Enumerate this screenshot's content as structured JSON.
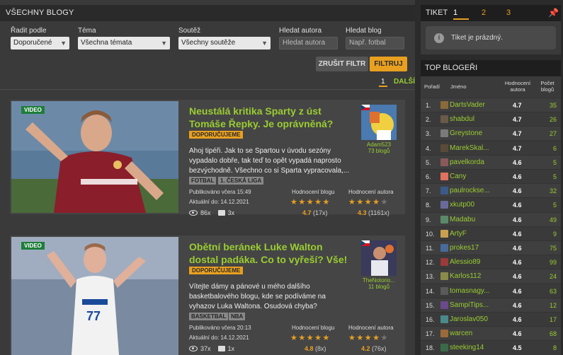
{
  "left": {
    "header": "VŠECHNY BLOGY",
    "filters": {
      "sort": {
        "label": "Řadit podle",
        "value": "Doporučené"
      },
      "topic": {
        "label": "Téma",
        "value": "Všechna témata"
      },
      "contest": {
        "label": "Soutěž",
        "value": "Všechny soutěže"
      },
      "author": {
        "label": "Hledat autora",
        "placeholder": "Hledat autora"
      },
      "blog": {
        "label": "Hledat blog",
        "placeholder": "Např. fotbal"
      }
    },
    "reset_label": "ZRUŠIT FILTR",
    "filter_label": "FILTRUJ",
    "pager": {
      "current": "1",
      "next": "DALŠÍ"
    }
  },
  "blogs": [
    {
      "badge": "VIDEO",
      "title": "Neustálá kritika Sparty z úst Tomáše Řepky. Je oprávněná?",
      "recommended": "DOPORUČUJEME",
      "excerpt": "Ahoj tipéři. Jak to se Spartou v úvodu sezóny vypadalo dobře, tak teď to opět vypadá naprosto bezvýchodně. Všechno co si Sparta vypracovala,...",
      "tags": [
        "FOTBAL",
        "1. ČESKÁ LIGA"
      ],
      "published": "Publikováno včera 15:49",
      "updated": "Aktuální do: 14.12.2021",
      "views": "86x",
      "comments": "3x",
      "blog_rating_label": "Hodnocení blogu",
      "author_rating_label": "Hodnocení autora",
      "blog_rating": "4.7",
      "blog_rating_count": "(17x)",
      "author_rating": "4.3",
      "author_rating_count": "(1161x)",
      "blog_stars": 5,
      "author_stars": 4,
      "author_name": "Adam523",
      "author_blogs": "73 blogů"
    },
    {
      "badge": "VIDEO",
      "title": "Obětní beránek Luke Walton dostal padáka. Co to vyřeší? Vše!",
      "recommended": "DOPORUČUJEME",
      "excerpt": "Vítejte dámy a pánové u mého dalšího basketbalového blogu, kde se podíváme na vyhazov Luka Waltona. Osudová chyba? Nemyslím...",
      "tags": [
        "BASKETBAL",
        "NBA"
      ],
      "published": "Publikováno včera 20:13",
      "updated": "Aktuální do: 14.12.2021",
      "views": "37x",
      "comments": "1x",
      "blog_rating_label": "Hodnocení blogu",
      "author_rating_label": "Hodnocení autora",
      "blog_rating": "4.8",
      "blog_rating_count": "(8x)",
      "author_rating": "4.2",
      "author_rating_count": "(76x)",
      "blog_stars": 5,
      "author_stars": 4,
      "author_name": "TheNotorio...",
      "author_blogs": "11 blogů"
    }
  ],
  "tiket": {
    "title": "TIKET",
    "tabs": [
      "1",
      "2",
      "3"
    ],
    "empty": "Tiket je prázdný."
  },
  "top": {
    "header": "TOP BLOGEŘI",
    "col_rank": "Pořadí",
    "col_name": "Jméno",
    "col_score": "Hodnocení autora",
    "col_count": "Počet blogů",
    "rows": [
      {
        "rank": "1.",
        "name": "DartsVader",
        "score": "4.7",
        "count": "35"
      },
      {
        "rank": "2.",
        "name": "shabdul",
        "score": "4.7",
        "count": "26"
      },
      {
        "rank": "3.",
        "name": "Greystone",
        "score": "4.7",
        "count": "27"
      },
      {
        "rank": "4.",
        "name": "MarekSkal...",
        "score": "4.7",
        "count": "6"
      },
      {
        "rank": "5.",
        "name": "pavelkorda",
        "score": "4.6",
        "count": "5"
      },
      {
        "rank": "6.",
        "name": "Cany",
        "score": "4.6",
        "count": "5"
      },
      {
        "rank": "7.",
        "name": "paulrockse...",
        "score": "4.6",
        "count": "32"
      },
      {
        "rank": "8.",
        "name": "xkutp00",
        "score": "4.6",
        "count": "5"
      },
      {
        "rank": "9.",
        "name": "Madabu",
        "score": "4.6",
        "count": "49"
      },
      {
        "rank": "10.",
        "name": "ArtyF",
        "score": "4.6",
        "count": "9"
      },
      {
        "rank": "11.",
        "name": "prokes17",
        "score": "4.6",
        "count": "75"
      },
      {
        "rank": "12.",
        "name": "Alessio89",
        "score": "4.6",
        "count": "99"
      },
      {
        "rank": "13.",
        "name": "Karlos112",
        "score": "4.6",
        "count": "24"
      },
      {
        "rank": "14.",
        "name": "tomasnagy...",
        "score": "4.6",
        "count": "63"
      },
      {
        "rank": "15.",
        "name": "SampiTips...",
        "score": "4.6",
        "count": "12"
      },
      {
        "rank": "16.",
        "name": "Jaroslav050",
        "score": "4.6",
        "count": "17"
      },
      {
        "rank": "17.",
        "name": "warcen",
        "score": "4.6",
        "count": "68"
      },
      {
        "rank": "18.",
        "name": "steeking14",
        "score": "4.5",
        "count": "8"
      }
    ]
  }
}
